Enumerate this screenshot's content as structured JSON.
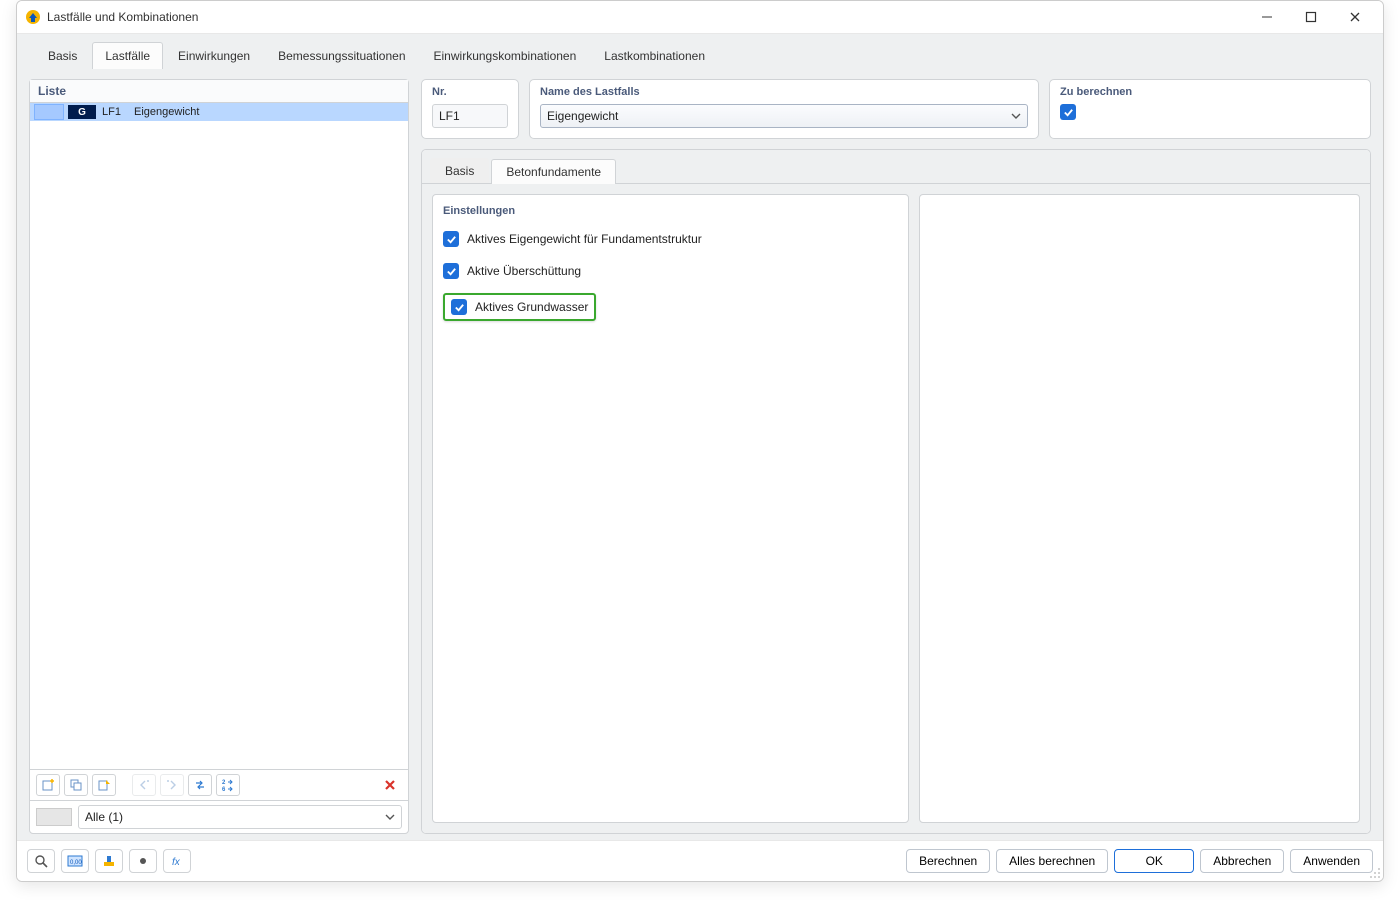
{
  "window": {
    "title": "Lastfälle und Kombinationen"
  },
  "main_tabs": {
    "items": [
      "Basis",
      "Lastfälle",
      "Einwirkungen",
      "Bemessungssituationen",
      "Einwirkungskombinationen",
      "Lastkombinationen"
    ],
    "active_index": 1
  },
  "left": {
    "header": "Liste",
    "row": {
      "badge": "G",
      "code": "LF1",
      "name": "Eigengewicht"
    },
    "filter": "Alle (1)"
  },
  "right": {
    "nr_label": "Nr.",
    "nr_value": "LF1",
    "name_label": "Name des Lastfalls",
    "name_value": "Eigengewicht",
    "calc_label": "Zu berechnen"
  },
  "sub_tabs": {
    "items": [
      "Basis",
      "Betonfundamente"
    ],
    "active_index": 1
  },
  "settings": {
    "header": "Einstellungen",
    "opt1": "Aktives Eigengewicht für Fundamentstruktur",
    "opt2": "Aktive Überschüttung",
    "opt3": "Aktives Grundwasser"
  },
  "footer": {
    "calc": "Berechnen",
    "calc_all": "Alles berechnen",
    "ok": "OK",
    "cancel": "Abbrechen",
    "apply": "Anwenden"
  },
  "icons": {
    "num_badge_a": "2",
    "num_badge_b": "6"
  }
}
